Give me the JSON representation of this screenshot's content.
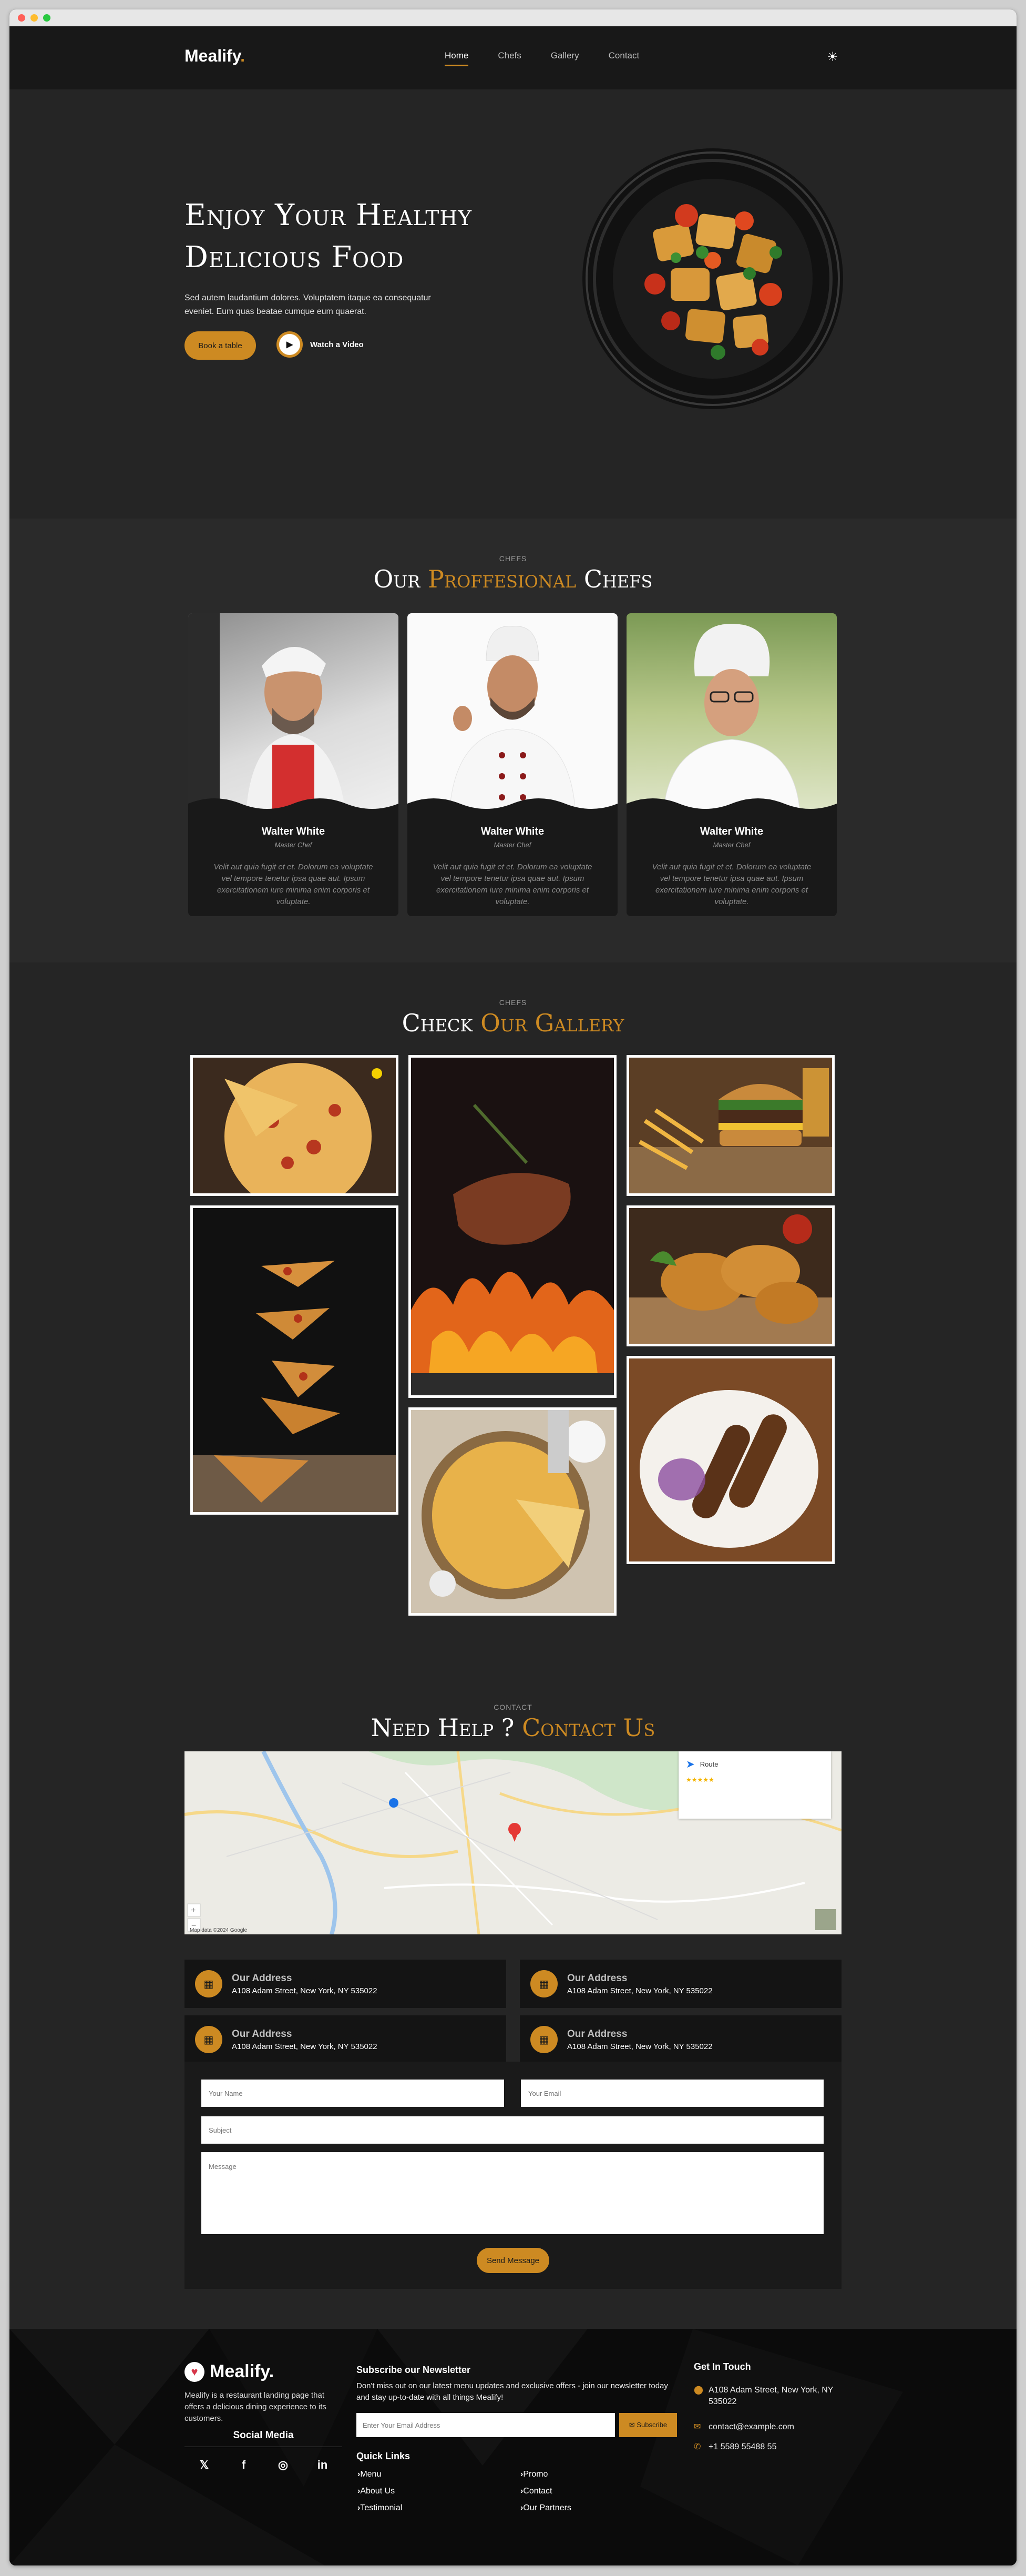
{
  "brand": {
    "name": "Mealify",
    "dot": ".",
    "accent_color": "#cd8a22"
  },
  "nav": {
    "items": [
      "Home",
      "Chefs",
      "Gallery",
      "Contact"
    ],
    "active": "Home",
    "theme_icon": "sun-icon"
  },
  "hero": {
    "title_line1": "Enjoy Your Healthy",
    "title_line2": "Delicious Food",
    "description": "Sed autem laudantium dolores. Voluptatem itaque ea consequatur eveniet. Eum quas beatae cumque eum quaerat.",
    "book_button": "Book a table",
    "watch_label": "Watch a Video"
  },
  "chefs": {
    "subtitle": "CHEFS",
    "title_part1": "Our",
    "title_accent": "Proffesional",
    "title_part2": "Chefs",
    "cards": [
      {
        "name": "Walter White",
        "role": "Master Chef",
        "text": "Velit aut quia fugit et et. Dolorum ea voluptate vel tempore tenetur ipsa quae aut. Ipsum exercitationem iure minima enim corporis et voluptate."
      },
      {
        "name": "Walter White",
        "role": "Master Chef",
        "text": "Velit aut quia fugit et et. Dolorum ea voluptate vel tempore tenetur ipsa quae aut. Ipsum exercitationem iure minima enim corporis et voluptate."
      },
      {
        "name": "Walter White",
        "role": "Master Chef",
        "text": "Velit aut quia fugit et et. Dolorum ea voluptate vel tempore tenetur ipsa quae aut. Ipsum exercitationem iure minima enim corporis et voluptate."
      }
    ]
  },
  "gallery": {
    "subtitle": "CHEFS",
    "title_part1": "Check",
    "title_accent": "Our Gallery"
  },
  "contact": {
    "subtitle": "CONTACT",
    "title_part1": "Need Help ?",
    "title_accent": "Contact Us",
    "map": {
      "route_label": "Route",
      "map_footer": "Map data ©2024 Google"
    },
    "addresses": [
      {
        "title": "Our Address",
        "text": "A108 Adam Street, New York, NY 535022"
      },
      {
        "title": "Our Address",
        "text": "A108 Adam Street, New York, NY 535022"
      },
      {
        "title": "Our Address",
        "text": "A108 Adam Street, New York, NY 535022"
      },
      {
        "title": "Our Address",
        "text": "A108 Adam Street, New York, NY 535022"
      }
    ],
    "form": {
      "name_placeholder": "Your Name",
      "email_placeholder": "Your Email",
      "subject_placeholder": "Subject",
      "message_placeholder": "Message",
      "send_button": "Send Message"
    }
  },
  "footer": {
    "brand": "Mealify.",
    "description": "Mealify is a restaurant landing page that offers a delicious dining experience to its customers.",
    "social_title": "Social Media",
    "social_icons": [
      "twitter-icon",
      "facebook-icon",
      "instagram-icon",
      "linkedin-icon"
    ],
    "newsletter_title": "Subscribe our Newsletter",
    "newsletter_text": "Don't miss out on our latest menu updates and exclusive offers - join our newsletter today and stay up-to-date with all things Mealify!",
    "newsletter_placeholder": "Enter Your Email Address",
    "subscribe_button": "Subscribe",
    "quick_links_title": "Quick Links",
    "quick_links_col1": [
      "Menu",
      "About Us",
      "Testimonial"
    ],
    "quick_links_col2": [
      "Promo",
      "Contact",
      "Our Partners"
    ],
    "touch_title": "Get In Touch",
    "touch_address": "A108 Adam Street, New York, NY 535022",
    "touch_email": "contact@example.com",
    "touch_phone": "+1 5589 55488 55"
  }
}
